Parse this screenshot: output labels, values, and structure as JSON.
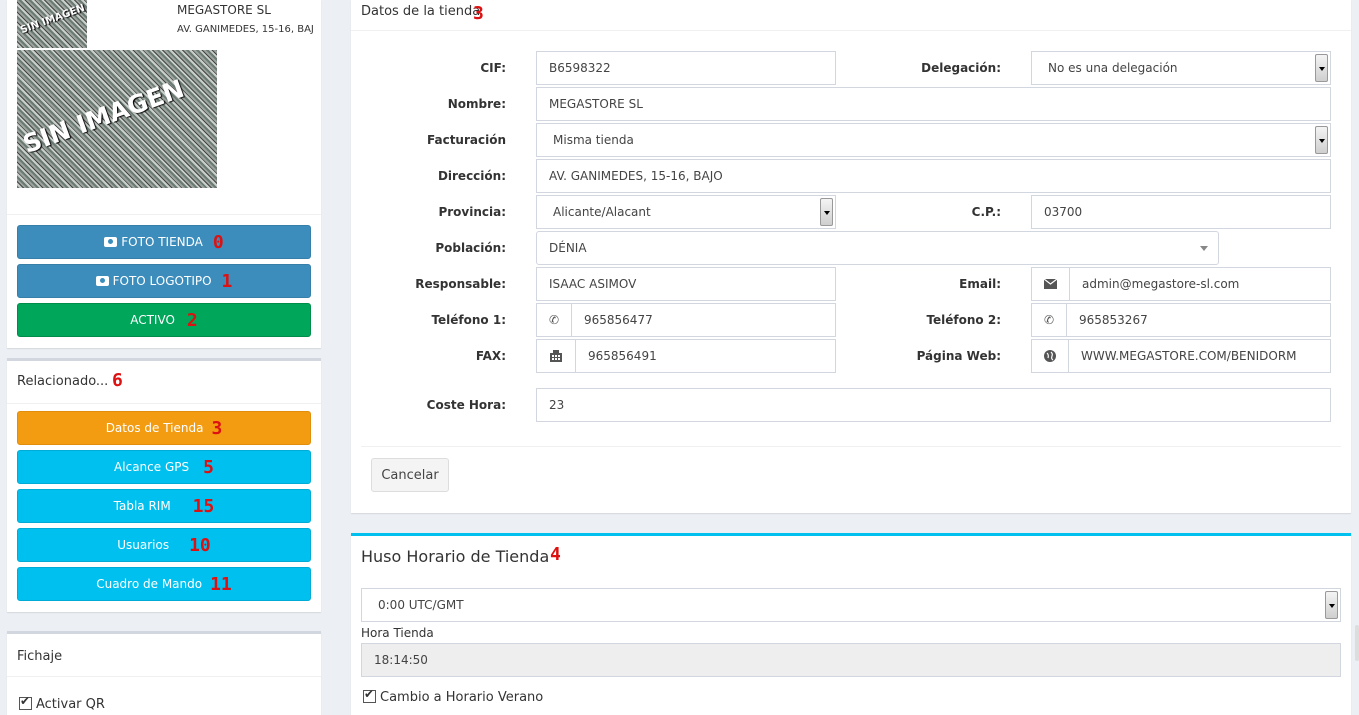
{
  "store": {
    "name": "MEGASTORE SL",
    "address": "AV. GANIMEDES, 15-16, BAJ",
    "no_image_text": "SIN IMAGEN"
  },
  "left_buttons": {
    "foto_tienda": "FOTO TIENDA",
    "foto_tienda_num": "0",
    "foto_logotipo": "FOTO LOGOTIPO",
    "foto_logotipo_num": "1",
    "activo": "ACTIVO",
    "activo_num": "2"
  },
  "related": {
    "title": "Relacionado...",
    "title_num": "6",
    "items": [
      {
        "label": "Datos de Tienda",
        "num": "3"
      },
      {
        "label": "Alcance GPS",
        "num": "5"
      },
      {
        "label": "Tabla RIM",
        "num": "15"
      },
      {
        "label": "Usuarios",
        "num": "10"
      },
      {
        "label": "Cuadro de Mando",
        "num": "11"
      }
    ]
  },
  "fichaje": {
    "title": "Fichaje",
    "activar_qr": "Activar QR"
  },
  "datos": {
    "title": "Datos de la tienda",
    "title_num": "3",
    "cif_label": "CIF:",
    "cif": "B6598322",
    "delegacion_label": "Delegación:",
    "delegacion": "No es una delegación",
    "nombre_label": "Nombre:",
    "nombre": "MEGASTORE SL",
    "facturacion_label": "Facturación",
    "facturacion": "Misma tienda",
    "direccion_label": "Dirección:",
    "direccion": "AV. GANIMEDES, 15-16, BAJO",
    "provincia_label": "Provincia:",
    "provincia": "Alicante/Alacant",
    "cp_label": "C.P.:",
    "cp": "03700",
    "poblacion_label": "Población:",
    "poblacion": "DÉNIA",
    "responsable_label": "Responsable:",
    "responsable": "ISAAC ASIMOV",
    "email_label": "Email:",
    "email": "admin@megastore-sl.com",
    "telefono1_label": "Teléfono 1:",
    "telefono1": "965856477",
    "telefono2_label": "Teléfono 2:",
    "telefono2": "965853267",
    "fax_label": "FAX:",
    "fax": "965856491",
    "web_label": "Página Web:",
    "web": "WWW.MEGASTORE.COM/BENIDORM",
    "coste_label": "Coste Hora:",
    "coste": "23",
    "cancel": "Cancelar"
  },
  "huso": {
    "title": "Huso Horario de Tienda",
    "title_num": "4",
    "timezone": "0:00 UTC/GMT",
    "hora_label": "Hora Tienda",
    "hora": "18:14:50",
    "verano": "Cambio a Horario Verano"
  },
  "colors": {
    "primary": "#3c8dbc",
    "success": "#00a65a",
    "warning": "#f39c12",
    "info": "#00c0ef",
    "annotation": "#dd1111"
  }
}
